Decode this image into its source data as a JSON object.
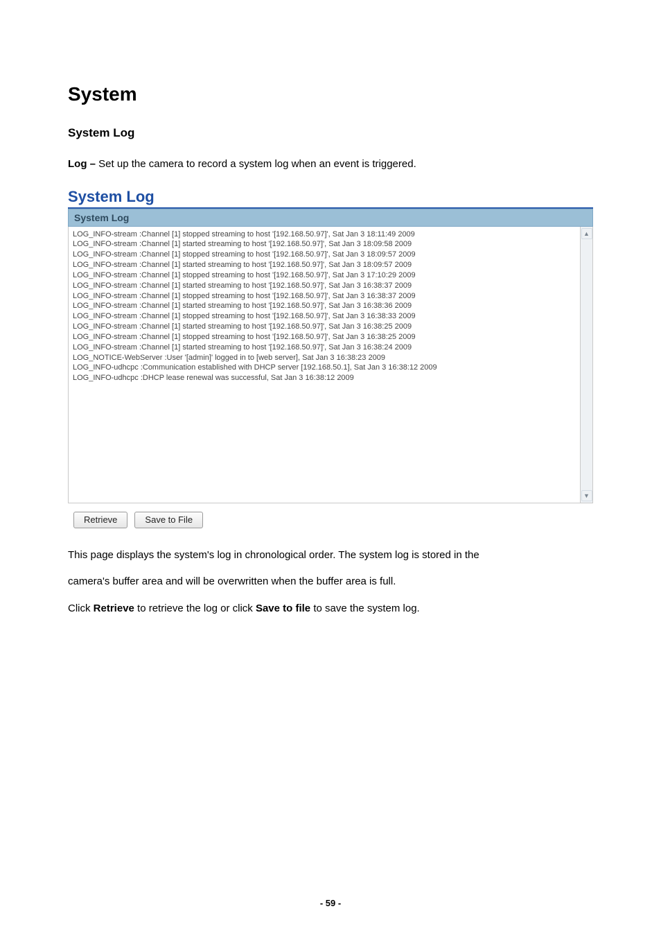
{
  "section_title": "System",
  "subsection_title": "System Log",
  "intro_line": {
    "bold": "Log –",
    "rest": " Set up the camera to record a system log when an event is triggered."
  },
  "panel": {
    "title": "System Log",
    "header": "System Log",
    "log_lines": [
      "LOG_INFO-stream :Channel [1] stopped streaming to host '[192.168.50.97]', Sat Jan 3 18:11:49 2009",
      "LOG_INFO-stream :Channel [1] started streaming to host '[192.168.50.97]', Sat Jan 3 18:09:58 2009",
      "LOG_INFO-stream :Channel [1] stopped streaming to host '[192.168.50.97]', Sat Jan 3 18:09:57 2009",
      "LOG_INFO-stream :Channel [1] started streaming to host '[192.168.50.97]', Sat Jan 3 18:09:57 2009",
      "LOG_INFO-stream :Channel [1] stopped streaming to host '[192.168.50.97]', Sat Jan 3 17:10:29 2009",
      "LOG_INFO-stream :Channel [1] started streaming to host '[192.168.50.97]', Sat Jan 3 16:38:37 2009",
      "LOG_INFO-stream :Channel [1] stopped streaming to host '[192.168.50.97]', Sat Jan 3 16:38:37 2009",
      "LOG_INFO-stream :Channel [1] started streaming to host '[192.168.50.97]', Sat Jan 3 16:38:36 2009",
      "LOG_INFO-stream :Channel [1] stopped streaming to host '[192.168.50.97]', Sat Jan 3 16:38:33 2009",
      "LOG_INFO-stream :Channel [1] started streaming to host '[192.168.50.97]', Sat Jan 3 16:38:25 2009",
      "LOG_INFO-stream :Channel [1] stopped streaming to host '[192.168.50.97]', Sat Jan 3 16:38:25 2009",
      "LOG_INFO-stream :Channel [1] started streaming to host '[192.168.50.97]', Sat Jan 3 16:38:24 2009",
      "LOG_NOTICE-WebServer :User '[admin]' logged in to [web server], Sat Jan 3 16:38:23 2009",
      "LOG_INFO-udhcpc :Communication established with DHCP server [192.168.50.1], Sat Jan 3 16:38:12 2009",
      "LOG_INFO-udhcpc :DHCP lease renewal was successful, Sat Jan 3 16:38:12 2009"
    ]
  },
  "buttons": {
    "retrieve": "Retrieve",
    "save": "Save to File"
  },
  "desc1": "This page displays the system's log in chronological order. The system log is stored in the",
  "desc2": "camera's buffer area and will be overwritten when the buffer area is full.",
  "desc3": {
    "pre": "Click ",
    "b1": "Retrieve",
    "mid": " to retrieve the log or click ",
    "b2": "Save to file",
    "post": " to save the system log."
  },
  "page_number": "- 59 -"
}
